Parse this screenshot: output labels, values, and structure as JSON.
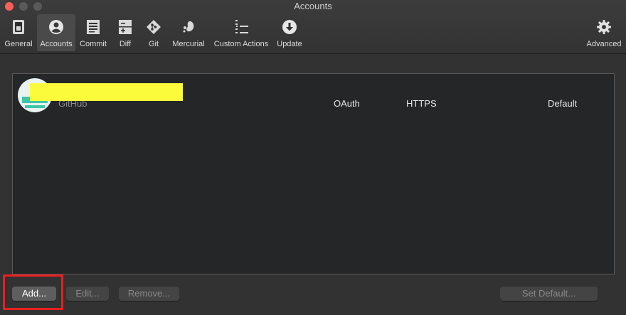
{
  "window": {
    "title": "Accounts"
  },
  "toolbar": {
    "items": [
      {
        "label": "General",
        "icon": "general-switch-icon"
      },
      {
        "label": "Accounts",
        "icon": "user-circle-icon",
        "active": true
      },
      {
        "label": "Commit",
        "icon": "commit-document-icon"
      },
      {
        "label": "Diff",
        "icon": "diff-plus-minus-icon"
      },
      {
        "label": "Git",
        "icon": "git-diamond-icon"
      },
      {
        "label": "Mercurial",
        "icon": "mercurial-droplet-icon"
      },
      {
        "label": "Custom Actions",
        "icon": "custom-actions-icon"
      },
      {
        "label": "Update",
        "icon": "download-circle-icon"
      }
    ],
    "advanced": {
      "label": "Advanced",
      "icon": "gear-icon"
    }
  },
  "accounts": [
    {
      "service": "GitHub",
      "auth": "OAuth",
      "protocol": "HTTPS",
      "default": "Default"
    }
  ],
  "buttons": {
    "add": "Add...",
    "edit": "Edit...",
    "remove": "Remove...",
    "set_default": "Set Default..."
  },
  "colors": {
    "highlight": "#e8201e",
    "redaction": "#fbfb3b",
    "avatar_accent": "#3ec6a8"
  }
}
